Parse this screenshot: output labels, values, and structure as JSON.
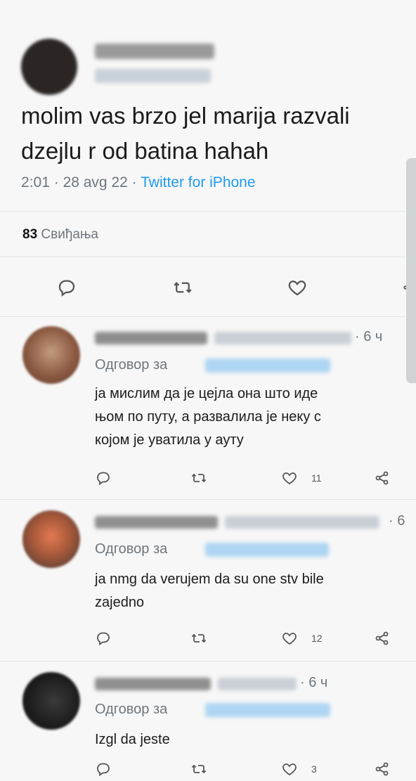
{
  "main_tweet": {
    "text_line1": "molim vas brzo jel marija razvali",
    "text_line2": "dzejlu r od batina hahah",
    "time": "2:01",
    "date": "28 avg 22",
    "client": "Twitter for iPhone",
    "likes_count": "83",
    "likes_label": "Свиђања"
  },
  "separator": "·",
  "replies": [
    {
      "time": "6 ч",
      "reply_to_label": "Одговор за",
      "line1": "ја мислим да је цејла она што иде",
      "line2": "њом по путу, а развалила је неку с",
      "line3": "којом је уватила у ауту",
      "likes": "11"
    },
    {
      "time": "6",
      "reply_to_label": "Одговор за",
      "line1": "ja nmg da verujem da su one stv bile",
      "line2": "zajedno",
      "likes": "12"
    },
    {
      "time": "6 ч",
      "reply_to_label": "Одговор за",
      "line1": "Izgl da jeste",
      "likes": "3"
    }
  ],
  "icons": [
    "reply-icon",
    "retweet-icon",
    "like-icon",
    "share-icon"
  ],
  "colors": {
    "link": "#1d9bf0",
    "muted": "#6e767d"
  }
}
